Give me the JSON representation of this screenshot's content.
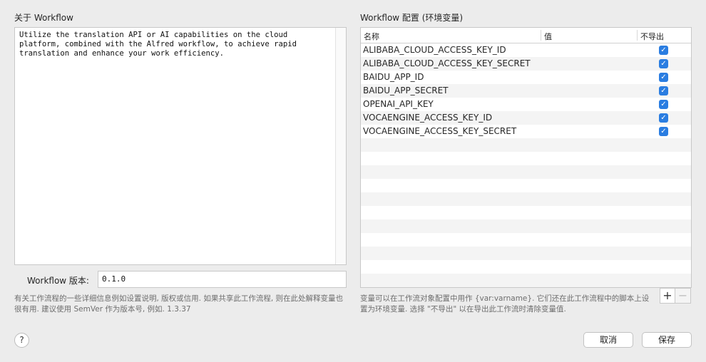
{
  "about": {
    "title": "关于 Workflow",
    "description": "Utilize the translation API or AI capabilities on the cloud\nplatform, combined with the Alfred workflow, to achieve rapid\ntranslation and enhance your work efficiency.",
    "version_label": "Workflow 版本:",
    "version_value": "0.1.0",
    "help_text": "有关工作流程的一些详细信息例如设置说明, 版权或信用. 如果共享此工作流程, 则在此处解释变量也很有用. 建议使用 SemVer 作为版本号, 例如. 1.3.37"
  },
  "env": {
    "title": "Workflow 配置 (环境变量)",
    "columns": [
      "名称",
      "值",
      "不导出"
    ],
    "rows": [
      {
        "name": "ALIBABA_CLOUD_ACCESS_KEY_ID",
        "value": "",
        "no_export": true
      },
      {
        "name": "ALIBABA_CLOUD_ACCESS_KEY_SECRET",
        "value": "",
        "no_export": true
      },
      {
        "name": "BAIDU_APP_ID",
        "value": "",
        "no_export": true
      },
      {
        "name": "BAIDU_APP_SECRET",
        "value": "",
        "no_export": true
      },
      {
        "name": "OPENAI_API_KEY",
        "value": "",
        "no_export": true
      },
      {
        "name": "VOCAENGINE_ACCESS_KEY_ID",
        "value": "",
        "no_export": true
      },
      {
        "name": "VOCAENGINE_ACCESS_KEY_SECRET",
        "value": "",
        "no_export": true
      }
    ],
    "help_text": "变量可以在工作流对象配置中用作 {var:varname}. 它们还在此工作流程中的脚本上设置为环境变量. 选择 \"不导出\" 以在导出此工作流时清除变量值.",
    "add_label": "+",
    "remove_label": "−",
    "checkmark": "✓"
  },
  "footer": {
    "help_label": "?",
    "cancel_label": "取消",
    "save_label": "保存"
  },
  "colors": {
    "checkbox": "#2a7de1",
    "background": "#ececec"
  }
}
